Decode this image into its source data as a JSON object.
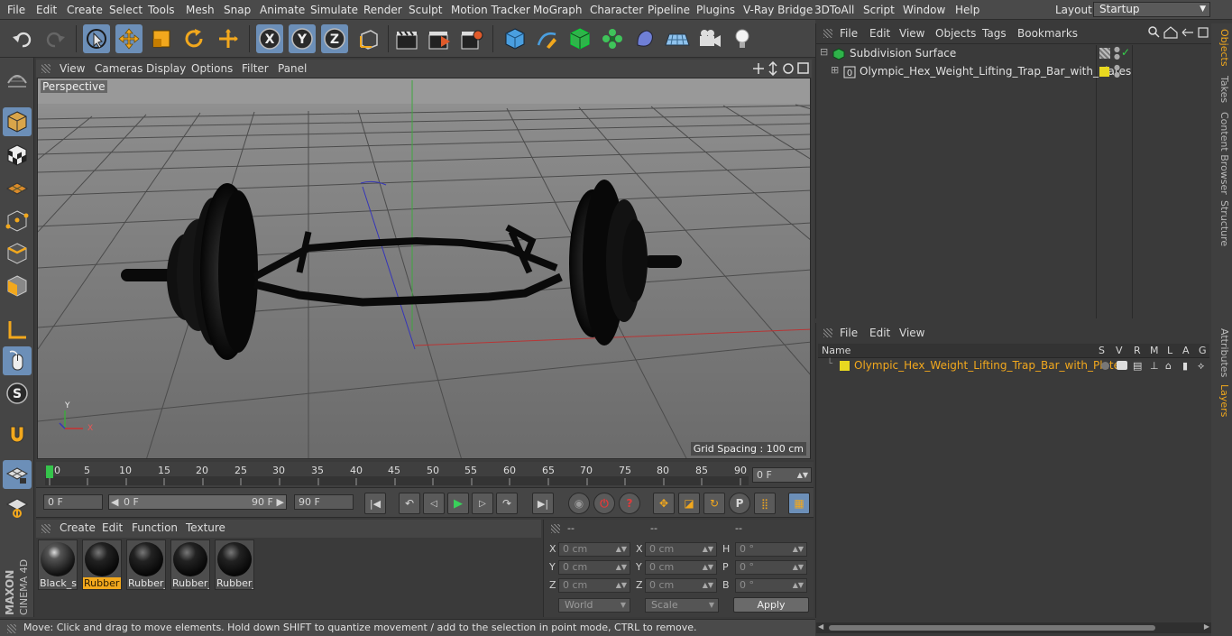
{
  "menubar": {
    "items": [
      "File",
      "Edit",
      "Create",
      "Select",
      "Tools",
      "Mesh",
      "Snap",
      "Animate",
      "Simulate",
      "Render",
      "Sculpt",
      "Motion Tracker",
      "MoGraph",
      "Character",
      "Pipeline",
      "Plugins",
      "V-Ray Bridge",
      "3DToAll",
      "Script",
      "Window",
      "Help"
    ],
    "layout_label": "Layout:",
    "layout_value": "Startup"
  },
  "viewport": {
    "menu": [
      "View",
      "Cameras",
      "Display",
      "Options",
      "Filter",
      "Panel"
    ],
    "camera_label": "Perspective",
    "grid_spacing": "Grid Spacing : 100 cm",
    "axis_labels": {
      "y": "Y",
      "x": "X"
    }
  },
  "timeline": {
    "ticks": [
      "0",
      "5",
      "10",
      "15",
      "20",
      "25",
      "30",
      "35",
      "40",
      "45",
      "50",
      "55",
      "60",
      "65",
      "70",
      "75",
      "80",
      "85",
      "90"
    ],
    "current_frame": "0 F"
  },
  "transport": {
    "start_field": "0 F",
    "range_start": "0 F",
    "range_end": "90 F",
    "end_field": "90 F"
  },
  "materials": {
    "menu": [
      "Create",
      "Edit",
      "Function",
      "Texture"
    ],
    "items": [
      {
        "label": "Black_st"
      },
      {
        "label": "Rubber"
      },
      {
        "label": "Rubber_"
      },
      {
        "label": "Rubber_"
      },
      {
        "label": "Rubber_"
      }
    ]
  },
  "coords": {
    "headers": [
      "--",
      "--",
      "--"
    ],
    "rows": [
      {
        "l1": "X",
        "v1": "0 cm",
        "l2": "X",
        "v2": "0 cm",
        "l3": "H",
        "v3": "0 °"
      },
      {
        "l1": "Y",
        "v1": "0 cm",
        "l2": "Y",
        "v2": "0 cm",
        "l3": "P",
        "v3": "0 °"
      },
      {
        "l1": "Z",
        "v1": "0 cm",
        "l2": "Z",
        "v2": "0 cm",
        "l3": "B",
        "v3": "0 °"
      }
    ],
    "mode_select": "World",
    "type_select": "Scale",
    "apply_label": "Apply"
  },
  "status": {
    "text": "Move: Click and drag to move elements. Hold down SHIFT to quantize movement / add to the selection in point mode, CTRL to remove."
  },
  "object_manager": {
    "menu": [
      "File",
      "Edit",
      "View",
      "Objects",
      "Tags",
      "Bookmarks"
    ],
    "objects": [
      {
        "name": "Subdivision Surface"
      },
      {
        "name": "Olympic_Hex_Weight_Lifting_Trap_Bar_with_Plates"
      }
    ]
  },
  "layer_manager": {
    "menu": [
      "File",
      "Edit",
      "View"
    ],
    "columns": {
      "name": "Name",
      "flags": [
        "S",
        "V",
        "R",
        "M",
        "L",
        "A",
        "G"
      ]
    },
    "layers": [
      {
        "name": "Olympic_Hex_Weight_Lifting_Trap_Bar_with_Plates"
      }
    ]
  },
  "right_tabs": [
    "Objects",
    "Takes",
    "Content Browser",
    "Structure",
    "Attributes",
    "Layers"
  ],
  "brand": {
    "line1": "MAXON",
    "line2": "CINEMA 4D"
  },
  "colors": {
    "accent": "#6c8fb8",
    "orange": "#f2a81d",
    "layer": "#e8d820"
  }
}
